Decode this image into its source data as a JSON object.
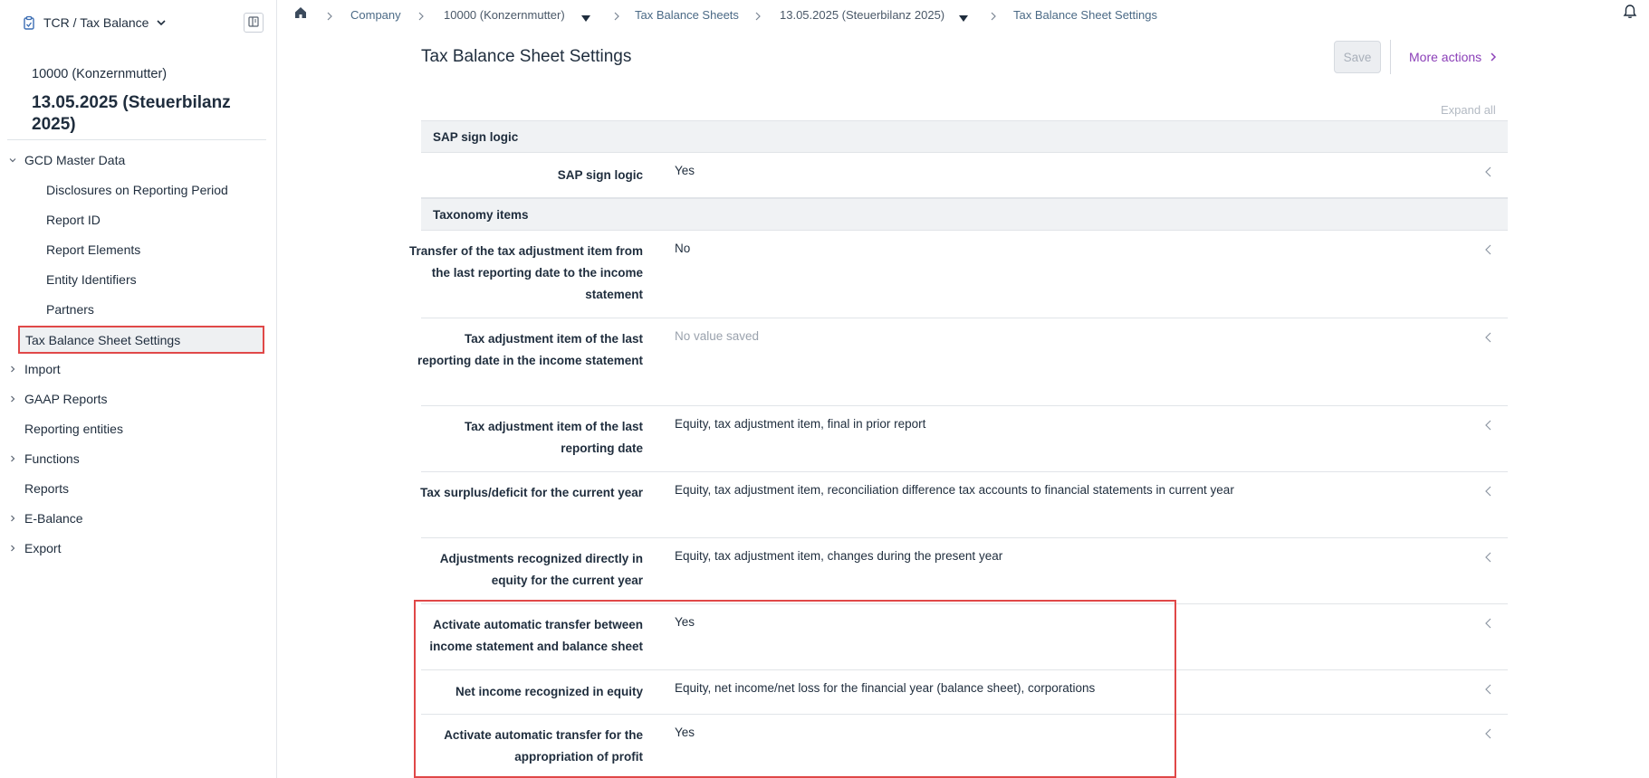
{
  "app": {
    "title": "TCR / Tax Balance"
  },
  "sidebar": {
    "company": "10000 (Konzernmutter)",
    "period": "13.05.2025 (Steuerbilanz 2025)",
    "items": [
      {
        "label": "GCD Master Data",
        "expandable": true,
        "expanded": true
      },
      {
        "label": "Disclosures on Reporting Period"
      },
      {
        "label": "Report ID"
      },
      {
        "label": "Report Elements"
      },
      {
        "label": "Entity Identifiers"
      },
      {
        "label": "Partners"
      },
      {
        "label": "Tax Balance Sheet Settings",
        "active": true
      },
      {
        "label": "Import",
        "expandable": true
      },
      {
        "label": "GAAP Reports",
        "expandable": true
      },
      {
        "label": "Reporting entities"
      },
      {
        "label": "Functions",
        "expandable": true
      },
      {
        "label": "Reports"
      },
      {
        "label": "E-Balance",
        "expandable": true
      },
      {
        "label": "Export",
        "expandable": true
      }
    ]
  },
  "breadcrumb": {
    "items": [
      "Company",
      "10000 (Konzernmutter)",
      "Tax Balance Sheets",
      "13.05.2025 (Steuerbilanz 2025)",
      "Tax Balance Sheet Settings"
    ]
  },
  "page": {
    "title": "Tax Balance Sheet Settings",
    "save_label": "Save",
    "more_actions_label": "More actions",
    "expand_all_label": "Expand all"
  },
  "sections": [
    {
      "title": "SAP sign logic",
      "rows": [
        {
          "label": "SAP sign logic",
          "value": "Yes"
        }
      ]
    },
    {
      "title": "Taxonomy items",
      "rows": [
        {
          "label": "Transfer of the tax adjustment item from the last reporting date to the income statement",
          "value": "No"
        },
        {
          "label": "Tax adjustment item of the last reporting date in the income statement",
          "value": "No value saved"
        },
        {
          "label": "Tax adjustment item of the last reporting date",
          "value": "Equity, tax adjustment item, final in prior report"
        },
        {
          "label": "Tax surplus/deficit for the current year",
          "value": "Equity, tax adjustment item, reconciliation difference tax accounts to financial statements in current year"
        },
        {
          "label": "Adjustments recognized directly in equity for the current year",
          "value": "Equity, tax adjustment item, changes during the present year"
        },
        {
          "label": "Activate automatic transfer between income statement and balance sheet",
          "value": "Yes"
        },
        {
          "label": "Net income recognized in equity",
          "value": "Equity, net income/net loss for the financial year (balance sheet), corporations"
        },
        {
          "label": "Activate automatic transfer for the appropriation of profit",
          "value": "Yes"
        }
      ]
    }
  ],
  "colors": {
    "accent": "#8b3fb8",
    "highlight": "#e04848",
    "section_bg": "#f0f2f4",
    "link": "#4b6a86"
  }
}
